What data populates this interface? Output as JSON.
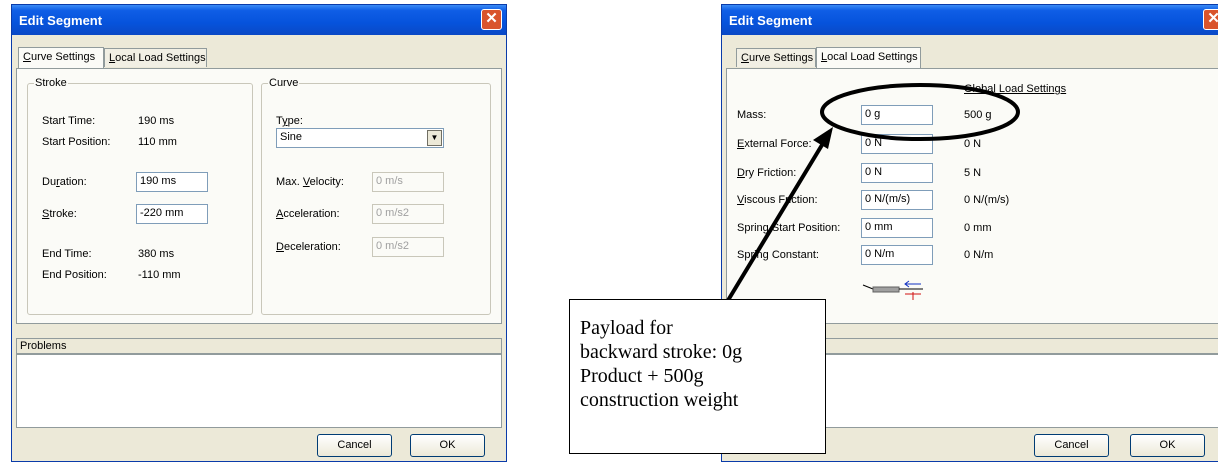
{
  "left_dialog": {
    "title": "Edit Segment",
    "tabs": [
      {
        "acc": "C",
        "rest": "urve Settings",
        "active": true
      },
      {
        "acc": "L",
        "rest": "ocal Load Settings",
        "active": false
      }
    ],
    "stroke_group": {
      "title": "Stroke",
      "start_time_label": "Start Time:",
      "start_time_value": "190 ms",
      "start_position_label": "Start Position:",
      "start_position_value": "110 mm",
      "duration_label_pre": "Du",
      "duration_label_acc": "r",
      "duration_label_post": "ation:",
      "duration_value": "190 ms",
      "stroke_label_acc": "S",
      "stroke_label_post": "troke:",
      "stroke_value": "-220 mm",
      "end_time_label": "End Time:",
      "end_time_value": "380 ms",
      "end_position_label": "End Position:",
      "end_position_value": "-110 mm"
    },
    "curve_group": {
      "title": "Curve",
      "type_label_pre": "T",
      "type_label_acc": "y",
      "type_label_post": "pe:",
      "type_value": "Sine",
      "max_velocity_label_pre": "Max. ",
      "max_velocity_label_acc": "V",
      "max_velocity_label_post": "elocity:",
      "max_velocity_value": "0 m/s",
      "acceleration_label_acc": "A",
      "acceleration_label_post": "cceleration:",
      "acceleration_value": "0 m/s2",
      "deceleration_label_acc": "D",
      "deceleration_label_post": "eceleration:",
      "deceleration_value": "0 m/s2"
    },
    "problems_label": "Problems",
    "cancel_label": "Cancel",
    "ok_label": "OK"
  },
  "right_dialog": {
    "title": "Edit Segment",
    "tabs": [
      {
        "acc": "C",
        "rest": "urve Settings",
        "active": false
      },
      {
        "acc": "L",
        "rest": "ocal Load Settings",
        "active": true
      }
    ],
    "global_header": "Global Load Settings",
    "rows": [
      {
        "label_acc": "",
        "label": "Mass:",
        "local": "0 g",
        "global": "500 g"
      },
      {
        "label_acc": "E",
        "label": "xternal Force:",
        "local": "0 N",
        "global": "0 N"
      },
      {
        "label_acc": "D",
        "label": "ry Friction:",
        "local": "0 N",
        "global": "5 N"
      },
      {
        "label_acc": "V",
        "label": "iscous Friction:",
        "local": "0 N/(m/s)",
        "global": "0 N/(m/s)"
      },
      {
        "label_acc": "",
        "label": "Spring Start Position:",
        "local": "0 mm",
        "global": "0 mm"
      },
      {
        "label_acc": "",
        "label": "Spring Constant:",
        "local": "0 N/m",
        "global": "0 N/m"
      }
    ],
    "cancel_label": "Cancel",
    "ok_label": "OK"
  },
  "annotation": {
    "lines": [
      "Payload for",
      "backward stroke: 0g",
      "Product + 500g",
      "construction weight"
    ]
  },
  "colors": {
    "titlebar": "#0653dc",
    "close_button": "#d9542c",
    "dialog_bg": "#ece9d8",
    "callout_ellipse": "#000000"
  },
  "icons": [
    "close-icon",
    "dropdown-arrow-icon",
    "spring-force-icon"
  ]
}
